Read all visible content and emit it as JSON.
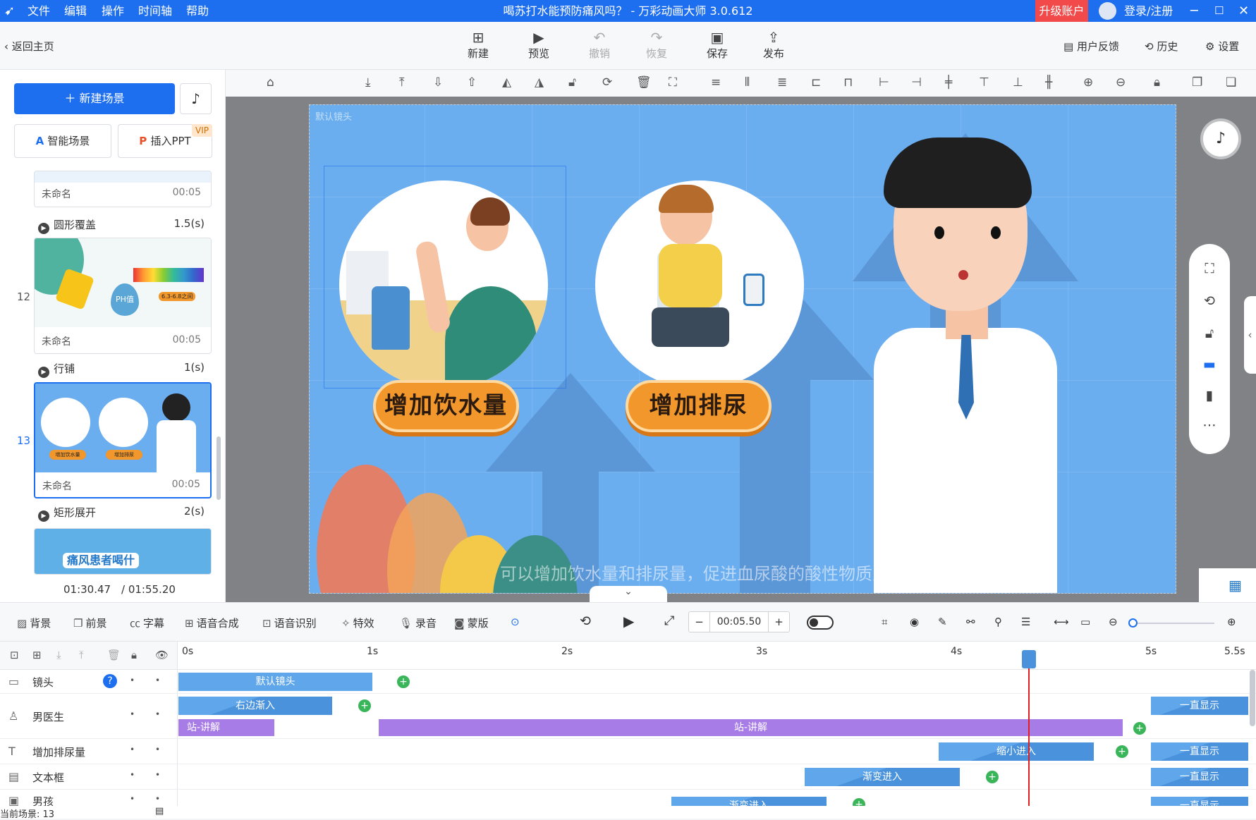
{
  "titlebar": {
    "menus": [
      "文件",
      "编辑",
      "操作",
      "时间轴",
      "帮助"
    ],
    "title": "喝苏打水能预防痛风吗？ - 万彩动画大师 3.0.612",
    "upgrade": "升级账户",
    "login": "登录/注册"
  },
  "toolbar": {
    "back": "返回主页",
    "new": "新建",
    "preview": "预览",
    "undo": "撤销",
    "redo": "恢复",
    "save": "保存",
    "publish": "发布",
    "feedback": "用户反馈",
    "history": "历史",
    "settings": "设置"
  },
  "left": {
    "new_scene": "新建场景",
    "smart_scene": "智能场景",
    "insert_ppt": "插入PPT",
    "vip": "VIP",
    "scenes": [
      {
        "num": "",
        "name": "未命名",
        "dur": "00:05"
      },
      {
        "num": "12",
        "name": "未命名",
        "dur": "00:05",
        "ph": "PH值",
        "range": "6.3-6.8之间"
      },
      {
        "num": "13",
        "name": "未命名",
        "dur": "00:05",
        "badge1": "增加饮水量",
        "badge2": "增加排尿"
      }
    ],
    "transitions": [
      {
        "name": "圆形覆盖",
        "dur": "1.5(s)"
      },
      {
        "name": "行铺",
        "dur": "1(s)"
      },
      {
        "name": "矩形展开",
        "dur": "2(s)"
      }
    ],
    "next_scene_title": "痛风患者喝什",
    "current_time": "01:30.47",
    "total_time": "/ 01:55.20"
  },
  "stage": {
    "camera_label": "默认镜头",
    "pill1": "增加饮水量",
    "pill2": "增加排尿",
    "subtitle": "可以增加饮水量和排尿量，促进血尿酸的酸性物质从肾脏排出"
  },
  "bottom": {
    "bg": "背景",
    "fg": "前景",
    "caption": "字幕",
    "tts": "语音合成",
    "asr": "语音识别",
    "fx": "特效",
    "record": "录音",
    "mask": "蒙版",
    "time": "00:05.50"
  },
  "timeline": {
    "ticks": [
      "0s",
      "1s",
      "2s",
      "3s",
      "4s",
      "5s",
      "5.5s"
    ],
    "tracks": [
      {
        "name": "镜头",
        "clips": [
          "默认镜头"
        ]
      },
      {
        "name": "男医生",
        "clips": [
          "右边渐入",
          "一直显示",
          "站-讲解",
          "站-讲解"
        ]
      },
      {
        "name": "增加排尿量",
        "clips": [
          "缩小进入",
          "一直显示"
        ]
      },
      {
        "name": "文本框",
        "clips": [
          "渐变进入",
          "一直显示"
        ]
      },
      {
        "name": "男孩",
        "clips": [
          "渐变进入",
          "一直显示"
        ]
      }
    ]
  },
  "status": "当前场景: 13",
  "colors": {
    "accent": "#1e6ff0",
    "stage": "#6aaef0",
    "pill": "#f2972b",
    "purple": "#a87ce6",
    "playhead": "#e02020"
  }
}
